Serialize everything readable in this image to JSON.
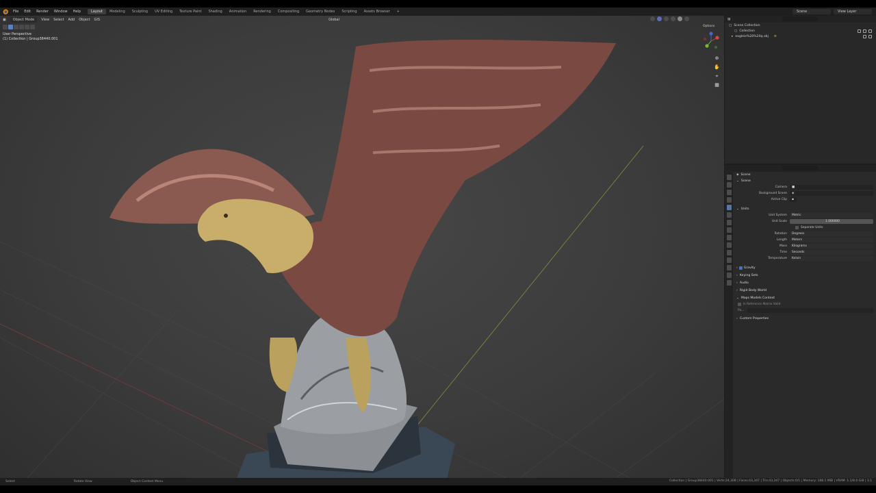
{
  "menu": [
    "File",
    "Edit",
    "Render",
    "Window",
    "Help"
  ],
  "workspaces": [
    {
      "label": "Layout",
      "active": true
    },
    {
      "label": "Modeling"
    },
    {
      "label": "Sculpting"
    },
    {
      "label": "UV Editing"
    },
    {
      "label": "Texture Paint"
    },
    {
      "label": "Shading"
    },
    {
      "label": "Animation"
    },
    {
      "label": "Rendering"
    },
    {
      "label": "Compositing"
    },
    {
      "label": "Geometry Nodes"
    },
    {
      "label": "Scripting"
    },
    {
      "label": "Assets Browser"
    }
  ],
  "top_add": "+",
  "scene_field": "Scene",
  "view_layer_field": "View Layer",
  "viewport": {
    "mode": "Object Mode",
    "menus": [
      "View",
      "Select",
      "Add",
      "Object",
      "GIS"
    ],
    "orientation": "Global",
    "options": "Options",
    "overlay_lines": [
      "User Perspective",
      "(1) Collection | Group38440.001"
    ]
  },
  "nav_icons": [
    "zoom-icon",
    "hand-icon",
    "camera-icon",
    "grid-icon"
  ],
  "outliner": {
    "rows": [
      {
        "label": "Scene Collection",
        "indent": 0
      },
      {
        "label": "Collection",
        "indent": 1
      },
      {
        "label": "eagleie%20%20q.obj",
        "indent": 2
      }
    ]
  },
  "properties": {
    "header": "Scene",
    "sections": [
      {
        "title": "Scene",
        "rows": [
          {
            "label": "Camera",
            "value": ""
          },
          {
            "label": "Background Scene",
            "value": ""
          },
          {
            "label": "Active Clip",
            "value": ""
          }
        ]
      },
      {
        "title": "Units",
        "rows": [
          {
            "label": "Unit System",
            "value": "Metric",
            "kind": "drop"
          },
          {
            "label": "Unit Scale",
            "value": "1.000000",
            "kind": "num"
          },
          {
            "label": "",
            "value": "Separate Units",
            "kind": "check"
          },
          {
            "label": "Rotation",
            "value": "Degrees",
            "kind": "drop"
          },
          {
            "label": "Length",
            "value": "Meters",
            "kind": "drop"
          },
          {
            "label": "Mass",
            "value": "Kilograms",
            "kind": "drop"
          },
          {
            "label": "Time",
            "value": "Seconds",
            "kind": "drop"
          },
          {
            "label": "Temperature",
            "value": "Kelvin",
            "kind": "drop"
          }
        ]
      }
    ],
    "collapsed": [
      "Gravity",
      "Keying Sets",
      "Audio",
      "Rigid Body World",
      "Maps Models Context"
    ],
    "extra": [
      "Is Reference Matrix Valid",
      "Pa..."
    ],
    "custom": "Custom Properties"
  },
  "status": {
    "left": [
      "Select",
      "Rotate View",
      "Object Context Menu"
    ],
    "right": "Collection | Group38440.001 | Verts:24,308 | Faces:43,347 | Tris:43,347 | Objects:0/1 | Memory: 188.1 MiB | VRAM: 1.1/8.0 GiB | 3.1"
  },
  "colors": {
    "accent": "#4772b3",
    "viewport_bg": "#3f3f3f",
    "panel": "#2a2a2a"
  }
}
